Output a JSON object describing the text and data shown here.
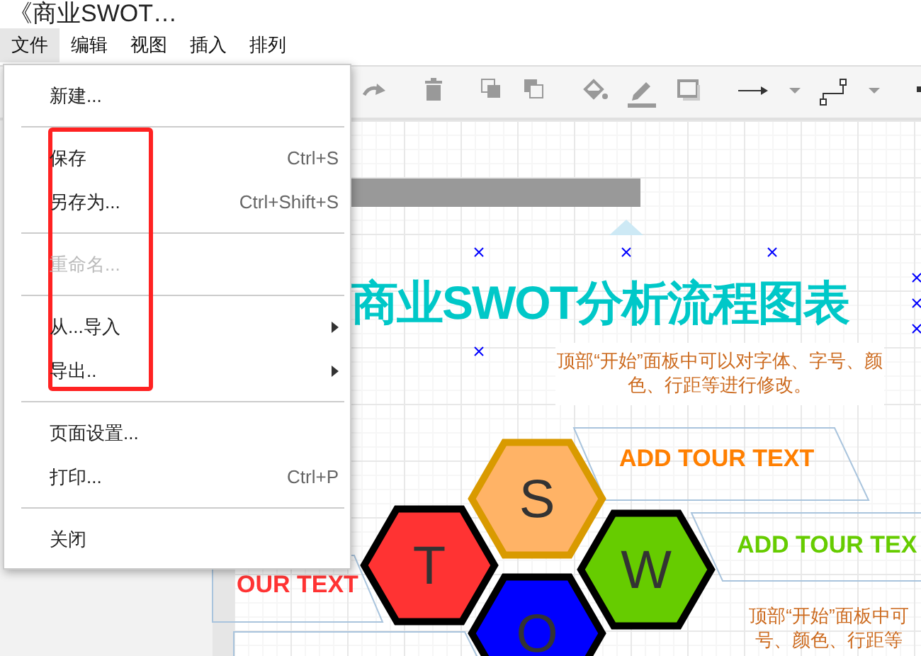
{
  "document_title": "《商业SWOT…",
  "menu_bar": [
    {
      "label": "文件",
      "selected": true
    },
    {
      "label": "编辑",
      "selected": false
    },
    {
      "label": "视图",
      "selected": false
    },
    {
      "label": "插入",
      "selected": false
    },
    {
      "label": "排列",
      "selected": false
    }
  ],
  "file_menu": [
    {
      "kind": "item",
      "label": "新建...",
      "disabled": false,
      "has_submenu": false
    },
    {
      "kind": "separator"
    },
    {
      "kind": "item",
      "label": "保存",
      "shortcut": "Ctrl+S",
      "disabled": false,
      "has_submenu": false
    },
    {
      "kind": "item",
      "label": "另存为...",
      "shortcut": "Ctrl+Shift+S",
      "disabled": false,
      "has_submenu": false
    },
    {
      "kind": "separator"
    },
    {
      "kind": "item",
      "label": "重命名...",
      "disabled": true,
      "has_submenu": false
    },
    {
      "kind": "separator"
    },
    {
      "kind": "item",
      "label": "从...导入",
      "disabled": false,
      "has_submenu": true
    },
    {
      "kind": "item",
      "label": "导出..",
      "disabled": false,
      "has_submenu": true
    },
    {
      "kind": "separator"
    },
    {
      "kind": "item",
      "label": "页面设置...",
      "disabled": false,
      "has_submenu": false
    },
    {
      "kind": "item",
      "label": "打印...",
      "shortcut": "Ctrl+P",
      "disabled": false,
      "has_submenu": false
    },
    {
      "kind": "separator"
    },
    {
      "kind": "item",
      "label": "关闭",
      "disabled": false,
      "has_submenu": false
    }
  ],
  "canvas": {
    "title": "商业SWOT分析流程图表",
    "tip": "顶部“开始”面板中可以对字体、字号、颜色、行距等进行修改。",
    "tip_2_lines": [
      "顶部“开始”面板中可",
      "号、颜色、行距等"
    ],
    "banners": [
      {
        "text": "ADD TOUR TEXT",
        "color": "#ff7f00"
      },
      {
        "text": "ADD TOUR TEX",
        "color": "#66cc00"
      },
      {
        "text": "OUR TEXT",
        "color": "#ff3333"
      }
    ],
    "hexagons": [
      {
        "letter": "S",
        "color": "#ffb366"
      },
      {
        "letter": "T",
        "color": "#ff3333"
      },
      {
        "letter": "W",
        "color": "#66cc00"
      },
      {
        "letter": "O",
        "color": "#0000ff"
      }
    ]
  }
}
